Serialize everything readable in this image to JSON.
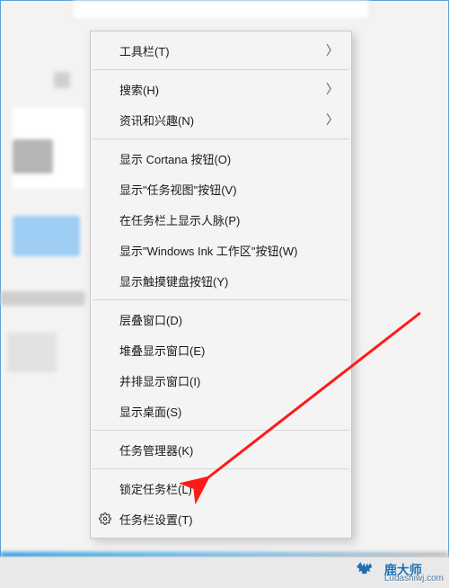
{
  "menu": {
    "items": [
      {
        "id": "toolbars",
        "label": "工具栏(T)",
        "submenu": true
      },
      {
        "sep": true
      },
      {
        "id": "search",
        "label": "搜索(H)",
        "submenu": true
      },
      {
        "id": "news",
        "label": "资讯和兴趣(N)",
        "submenu": true
      },
      {
        "sep": true
      },
      {
        "id": "cortana",
        "label": "显示 Cortana 按钮(O)"
      },
      {
        "id": "taskview",
        "label": "显示\"任务视图\"按钮(V)"
      },
      {
        "id": "people",
        "label": "在任务栏上显示人脉(P)"
      },
      {
        "id": "ink",
        "label": "显示\"Windows Ink 工作区\"按钮(W)"
      },
      {
        "id": "touchkbd",
        "label": "显示触摸键盘按钮(Y)"
      },
      {
        "sep": true
      },
      {
        "id": "cascade",
        "label": "层叠窗口(D)"
      },
      {
        "id": "stacked",
        "label": "堆叠显示窗口(E)"
      },
      {
        "id": "sidebyside",
        "label": "并排显示窗口(I)"
      },
      {
        "id": "showdesktop",
        "label": "显示桌面(S)"
      },
      {
        "sep": true
      },
      {
        "id": "taskmanager",
        "label": "任务管理器(K)"
      },
      {
        "sep": true
      },
      {
        "id": "locktaskbar",
        "label": "锁定任务栏(L)"
      },
      {
        "id": "taskbarsettings",
        "label": "任务栏设置(T)",
        "icon": "gear"
      }
    ]
  },
  "watermark": {
    "brand": "鹿大师",
    "url": "Ludashiwj.com"
  },
  "annotation": {
    "target_item_id": "taskmanager"
  }
}
